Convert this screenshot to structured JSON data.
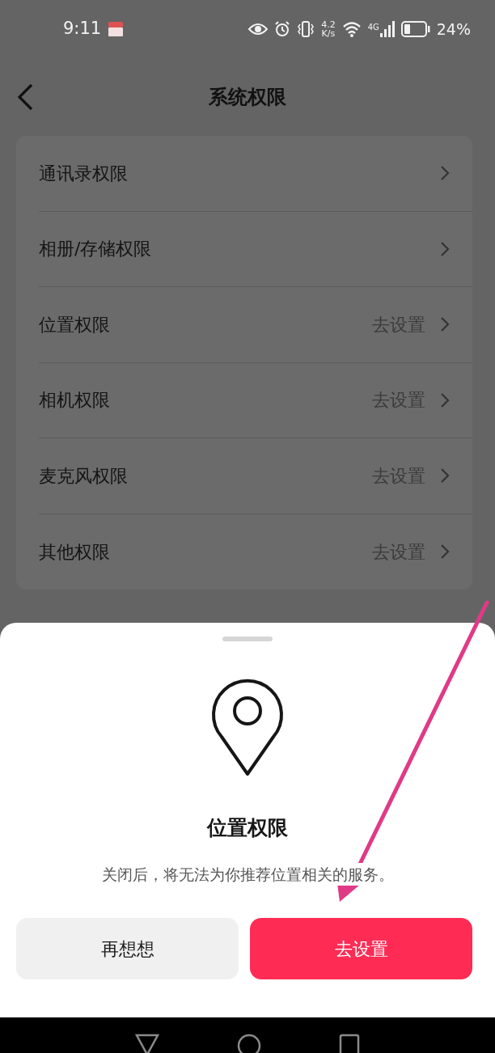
{
  "status_bar": {
    "time": "9:11",
    "speed_value": "4.2",
    "speed_unit": "K/s",
    "network_type": "4G",
    "battery": "24%"
  },
  "header": {
    "title": "系统权限"
  },
  "permissions": [
    {
      "label": "通讯录权限"
    },
    {
      "label": "相册/存储权限"
    },
    {
      "label": "位置权限",
      "action": "去设置"
    },
    {
      "label": "相机权限",
      "action": "去设置"
    },
    {
      "label": "麦克风权限",
      "action": "去设置"
    },
    {
      "label": "其他权限",
      "action": "去设置"
    }
  ],
  "sheet": {
    "title": "位置权限",
    "description": "关闭后，将无法为你推荐位置相关的服务。",
    "buttons": [
      {
        "label": "再想想",
        "kind": "secondary"
      },
      {
        "label": "去设置",
        "kind": "primary"
      }
    ]
  }
}
